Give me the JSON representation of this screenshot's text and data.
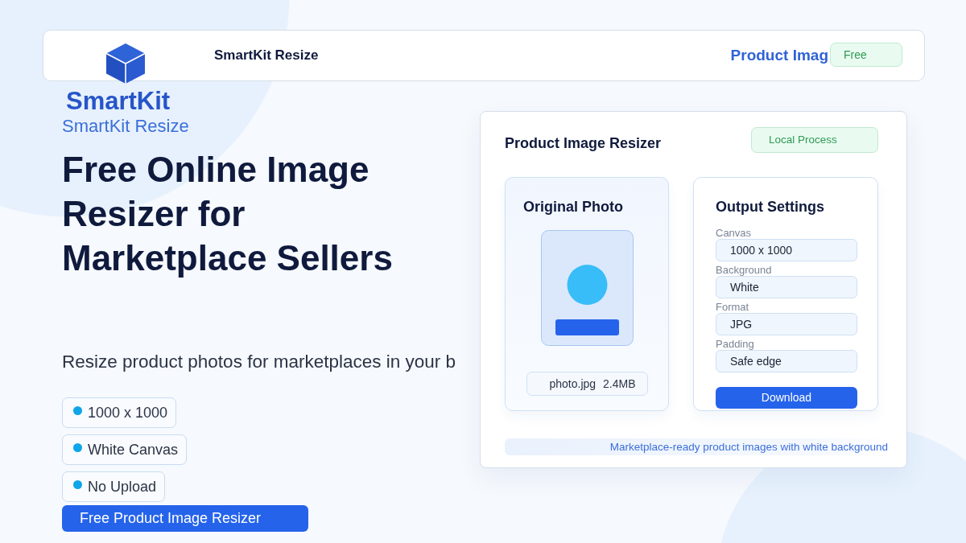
{
  "header": {
    "title": "SmartKit Resize",
    "nav_link": "Product Imag",
    "badge": "Free"
  },
  "brand": {
    "wordmark": "SmartKit",
    "subtitle": "SmartKit Resize"
  },
  "hero": {
    "heading": "Free Online Image Resizer for Marketplace Sellers",
    "subtitle": "Resize product photos for marketplaces in your b",
    "features": [
      "1000 x 1000",
      "White Canvas",
      "No Upload"
    ],
    "cta": "Free Product Image Resizer"
  },
  "tool_card": {
    "title": "Product Image Resizer",
    "badge": "Local Process",
    "original": {
      "title": "Original Photo",
      "file_name": "photo.jpg",
      "file_size": "2.4MB"
    },
    "settings": {
      "title": "Output Settings",
      "fields": [
        {
          "label": "Canvas",
          "value": "1000 x 1000"
        },
        {
          "label": "Background",
          "value": "White"
        },
        {
          "label": "Format",
          "value": "JPG"
        },
        {
          "label": "Padding",
          "value": "Safe edge"
        }
      ],
      "button": "Download"
    },
    "footer_note": "Marketplace-ready product images with white background"
  }
}
